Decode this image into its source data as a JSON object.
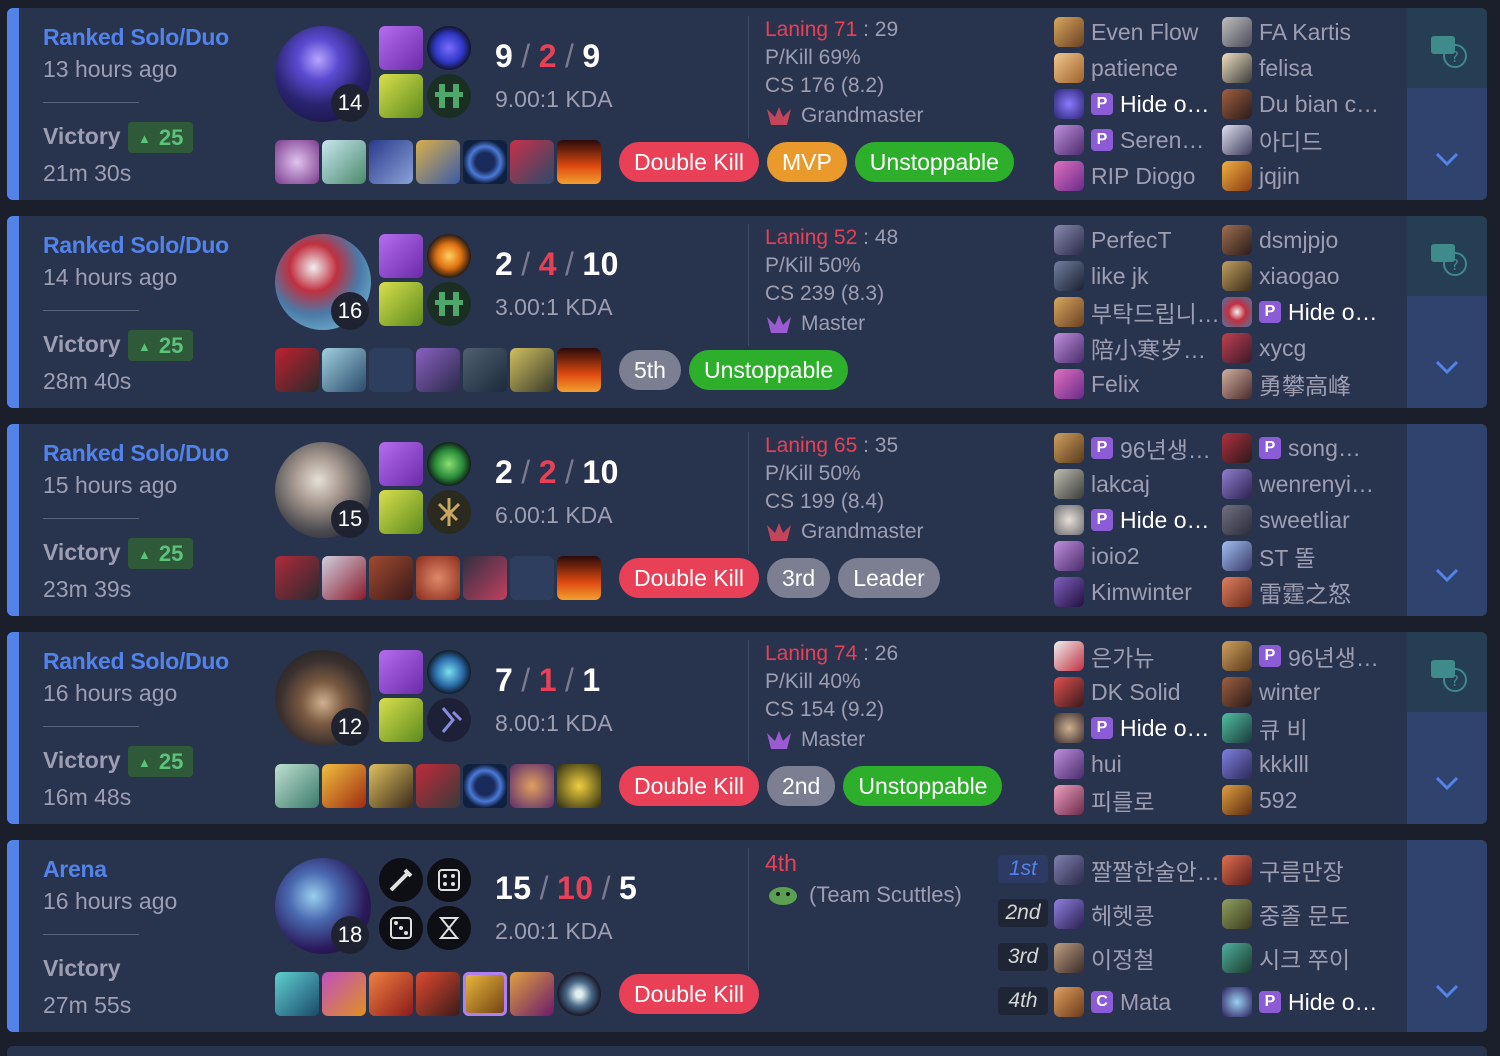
{
  "matches": [
    {
      "queue": "Ranked Solo/Duo",
      "ago": "13 hours ago",
      "result": "Victory",
      "lp": "25",
      "duration": "21m 30s",
      "level": "14",
      "kills": "9",
      "deaths": "2",
      "assists": "9",
      "kda": "9.00:1 KDA",
      "tags": [
        "Double Kill",
        "MVP",
        "Unstoppable"
      ],
      "laning": "Laning 71",
      "laning_opp": " : 29",
      "pkill": "P/Kill 69%",
      "cs": "CS 176 (8.2)",
      "rank": "Grandmaster",
      "players_left": [
        "Even Flow",
        "patience",
        "Hide o…",
        "Seren…",
        "RIP Diogo"
      ],
      "players_right": [
        "FA Kartis",
        "felisa",
        "Du bian c…",
        "아디드",
        "jqjin"
      ]
    },
    {
      "queue": "Ranked Solo/Duo",
      "ago": "14 hours ago",
      "result": "Victory",
      "lp": "25",
      "duration": "28m 40s",
      "level": "16",
      "kills": "2",
      "deaths": "4",
      "assists": "10",
      "kda": "3.00:1 KDA",
      "tags": [
        "5th",
        "Unstoppable"
      ],
      "laning": "Laning 52",
      "laning_opp": " : 48",
      "pkill": "P/Kill 50%",
      "cs": "CS 239 (8.3)",
      "rank": "Master",
      "players_left": [
        "PerfecT",
        "like jk",
        "부탁드립니…",
        "陪小寒岁…",
        "Felix"
      ],
      "players_right": [
        "dsmjpjo",
        "xiaogao",
        "Hide o…",
        "xycg",
        "勇攀高峰"
      ]
    },
    {
      "queue": "Ranked Solo/Duo",
      "ago": "15 hours ago",
      "result": "Victory",
      "lp": "25",
      "duration": "23m 39s",
      "level": "15",
      "kills": "2",
      "deaths": "2",
      "assists": "10",
      "kda": "6.00:1 KDA",
      "tags": [
        "Double Kill",
        "3rd",
        "Leader"
      ],
      "laning": "Laning 65",
      "laning_opp": " : 35",
      "pkill": "P/Kill 50%",
      "cs": "CS 199 (8.4)",
      "rank": "Grandmaster",
      "players_left": [
        "96년생…",
        "lakcaj",
        "Hide o…",
        "ioio2",
        "Kimwinter"
      ],
      "players_right": [
        "song…",
        "wenrenyi…",
        "sweetliar",
        "ST 똘",
        "雷霆之怒"
      ]
    },
    {
      "queue": "Ranked Solo/Duo",
      "ago": "16 hours ago",
      "result": "Victory",
      "lp": "25",
      "duration": "16m 48s",
      "level": "12",
      "kills": "7",
      "deaths": "1",
      "assists": "1",
      "kda": "8.00:1 KDA",
      "tags": [
        "Double Kill",
        "2nd",
        "Unstoppable"
      ],
      "laning": "Laning 74",
      "laning_opp": " : 26",
      "pkill": "P/Kill 40%",
      "cs": "CS 154 (9.2)",
      "rank": "Master",
      "players_left": [
        "은가뉴",
        "DK Solid",
        "Hide o…",
        "hui",
        "피를로"
      ],
      "players_right": [
        "96년생…",
        "winter",
        "큐 비",
        "kkklll",
        "592"
      ]
    },
    {
      "queue": "Arena",
      "ago": "16 hours ago",
      "result": "Victory",
      "duration": "27m 55s",
      "level": "18",
      "kills": "15",
      "deaths": "10",
      "assists": "5",
      "kda": "2.00:1 KDA",
      "tags": [
        "Double Kill"
      ],
      "placement": "4th",
      "team": "(Team Scuttles)",
      "places": [
        "1st",
        "2nd",
        "3rd",
        "4th"
      ],
      "players_left": [
        "짤짤한술안…",
        "헤헷콩",
        "이정철",
        "Mata"
      ],
      "players_right": [
        "구름만장",
        "중졸 문도",
        "시크 쭈이",
        "Hide o…"
      ]
    }
  ],
  "badges": {
    "premium": "P",
    "coach": "C"
  },
  "colors": {
    "win_bar": "#5383e8",
    "card_bg": "#28344e",
    "death_red": "#e84057",
    "lp_green": "#5ec27a"
  },
  "icons": [
    "question-chat-icon",
    "chevron-down-icon",
    "rank-emblem-icon"
  ]
}
